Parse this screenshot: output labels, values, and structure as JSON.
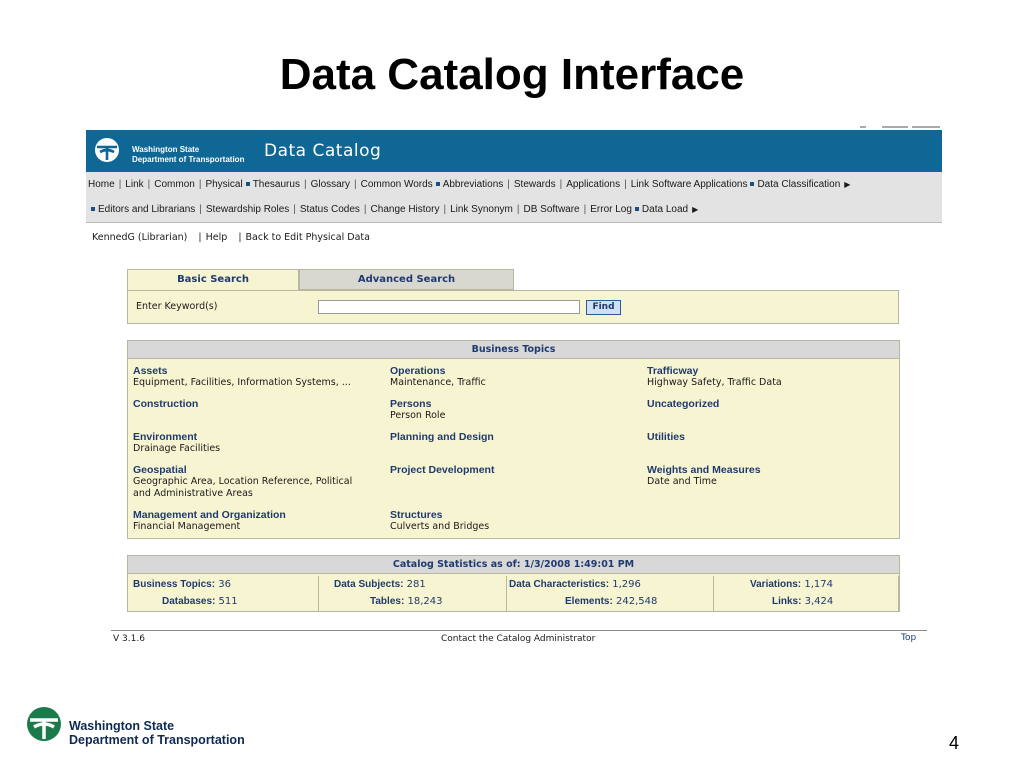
{
  "slide": {
    "title": "Data Catalog Interface",
    "page_number": "4",
    "logo_text_line1": "Washington State",
    "logo_text_line2": "Department of Transportation"
  },
  "app": {
    "banner_logo_line1": "Washington State",
    "banner_logo_line2": "Department of Transportation",
    "title": "Data Catalog",
    "nav_row1": [
      "Home",
      "Link",
      "Common",
      "Physical",
      "Thesaurus",
      "Glossary",
      "Common Words",
      "Abbreviations",
      "Stewards",
      "Applications",
      "Link Software Applications",
      "Data Classification"
    ],
    "nav_row2": [
      "Editors and Librarians",
      "Stewardship Roles",
      "Status Codes",
      "Change History",
      "Link Synonym",
      "DB Software",
      "Error Log",
      "Data Load"
    ],
    "user": {
      "name": "KennedG (Librarian)",
      "help": "Help",
      "back": "Back to Edit Physical Data"
    },
    "search": {
      "tab_basic": "Basic Search",
      "tab_advanced": "Advanced Search",
      "label": "Enter Keyword(s)",
      "value": "",
      "button": "Find"
    },
    "topics": {
      "header": "Business Topics",
      "items": [
        {
          "title": "Assets",
          "desc": "Equipment, Facilities, Information Systems, ..."
        },
        {
          "title": "Operations",
          "desc": "Maintenance, Traffic"
        },
        {
          "title": "Trafficway",
          "desc": "Highway Safety, Traffic Data"
        },
        {
          "title": "Construction",
          "desc": ""
        },
        {
          "title": "Persons",
          "desc": "Person Role"
        },
        {
          "title": "Uncategorized",
          "desc": ""
        },
        {
          "title": "Environment",
          "desc": "Drainage Facilities"
        },
        {
          "title": "Planning and Design",
          "desc": ""
        },
        {
          "title": "Utilities",
          "desc": ""
        },
        {
          "title": "Geospatial",
          "desc": "Geographic Area, Location Reference, Political and Administrative Areas"
        },
        {
          "title": "Project Development",
          "desc": ""
        },
        {
          "title": "Weights and Measures",
          "desc": "Date and Time"
        },
        {
          "title": "Management and Organization",
          "desc": "Financial Management"
        },
        {
          "title": "Structures",
          "desc": "Culverts and Bridges"
        }
      ]
    },
    "stats": {
      "header": "Catalog Statistics as of: 1/3/2008 1:49:01 PM",
      "business_topics": {
        "label": "Business Topics:",
        "value": "36"
      },
      "data_subjects": {
        "label": "Data Subjects:",
        "value": "281"
      },
      "data_characteristics": {
        "label": "Data Characteristics:",
        "value": "1,296"
      },
      "variations": {
        "label": "Variations:",
        "value": "1,174"
      },
      "databases": {
        "label": "Databases:",
        "value": "511"
      },
      "tables": {
        "label": "Tables:",
        "value": "18,243"
      },
      "elements": {
        "label": "Elements:",
        "value": "242,548"
      },
      "links": {
        "label": "Links:",
        "value": "3,424"
      }
    },
    "footer": {
      "version": "V 3.1.6",
      "contact": "Contact the Catalog Administrator",
      "top": "Top"
    }
  }
}
